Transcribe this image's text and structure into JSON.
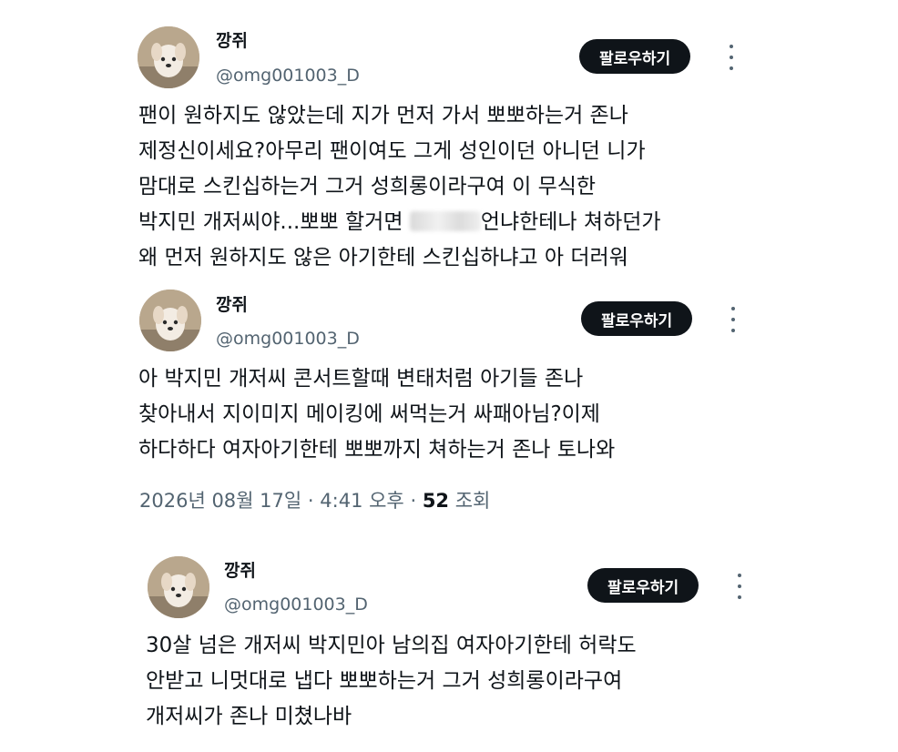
{
  "posts": [
    {
      "name": "깡쥐",
      "handle": "@omg001003_D",
      "follow_label": "팔로우하기",
      "text": [
        "팬이 원하지도 않았는데 지가 먼저 가서 뽀뽀하는거 존나",
        "제정신이세요?아무리 팬이여도 그게 성인이던 아니던 니가",
        "맘대로 스킨십하는거 그거 성희롱이라구여 이 무식한",
        "박지민 개저씨야...뽀뽀 할거면 ",
        "언냐한테나 쳐하던가",
        "왜 먼저 원하지도 않은 아기한테 스킨십하냐고 아 더러워"
      ]
    },
    {
      "name": "깡쥐",
      "handle": "@omg001003_D",
      "follow_label": "팔로우하기",
      "text": [
        "아 박지민 개저씨 콘서트할때 변태처럼 아기들 존나",
        "찾아내서 지이미지 메이킹에 써먹는거 싸패아님?이제",
        "하다하다 여자아기한테 뽀뽀까지 쳐하는거 존나 토나와"
      ],
      "meta": {
        "date": "2026년 08월 17일",
        "sep1": "·",
        "time": "4:41 오후",
        "sep2": "·",
        "views_count": "52",
        "views_label": "조회"
      }
    },
    {
      "name": "깡쥐",
      "handle": "@omg001003_D",
      "follow_label": "팔로우하기",
      "text": [
        "30살 넘은 개저씨 박지민아 남의집 여자아기한테 허락도",
        "안받고 니멋대로 냅다 뽀뽀하는거 그거 성희롱이라구여",
        "개저씨가 존나 미쳤나바"
      ]
    }
  ],
  "colors": {
    "text": "#0f1419",
    "secondary": "#536471",
    "button_bg": "#0f1419",
    "button_text": "#ffffff"
  },
  "icons": {
    "more": "more-dots-vertical-icon",
    "avatar": "puppy-avatar-photo"
  }
}
